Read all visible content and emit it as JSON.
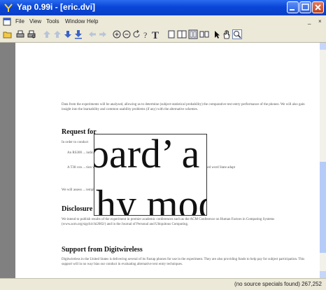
{
  "window": {
    "title": "Yap 0.99i - [eric.dvi]"
  },
  "menu": {
    "items": [
      "File",
      "View",
      "Tools",
      "Window",
      "Help"
    ],
    "mdi_controls": [
      "_",
      "×"
    ]
  },
  "toolbar": {
    "icons": [
      "open-icon",
      "print-icon",
      "print-preview-icon",
      "first-page-icon",
      "prev-page-icon",
      "next-page-icon",
      "last-page-icon",
      "back-icon",
      "forward-icon",
      "zoom-in-icon",
      "zoom-out-icon",
      "refresh-icon",
      "search-icon",
      "text-icon",
      "single-page-icon",
      "double-page-icon",
      "continuous-icon",
      "book-icon",
      "arrow-tool-icon",
      "hand-tool-icon",
      "magnifier-tool-icon"
    ]
  },
  "document": {
    "intro": "Data from the experiments will be analysed, allowing us to determine (subject-statistical probability) the comparative text-entry performance of the phones. We will also gain insight into the learnability and common usability problems (if any) with the alternative schemes.",
    "section1_heading": "Request for",
    "section1_intro": "In order to conduct",
    "bullet1": "An RS300 ... indicated input with the soft 'Qwerty' keypad. We",
    "bullet2": "A T38 con ... tion we assess both predictive text entry and the ... keypad with mini entry and a chorded word State adapt",
    "section1_closing": "We will assess ... template.",
    "section2_heading": "Disclosure",
    "section2_text": "We intend to publish results of the experiment in premier academic conferences such as the ACM Conference on Human Factors in Computing Systems (www.acm.org/sigchi/chi2002/) and in the Journal of Personal and Ubiquitous Computing.",
    "section3_heading": "Support from Digitwireless",
    "section3_text": "Digitwireless in the United States is delivering several of its Fastap phones for use in the experiment. They are also providing funds to help pay for subject participation. This support will in no way bias our conduct in evaluating alternative text entry techniques.",
    "magnifier_line1": "oard’ a",
    "magnifier_line2": "hy mod"
  },
  "status": {
    "message": "(no source specials found)   267,252"
  }
}
